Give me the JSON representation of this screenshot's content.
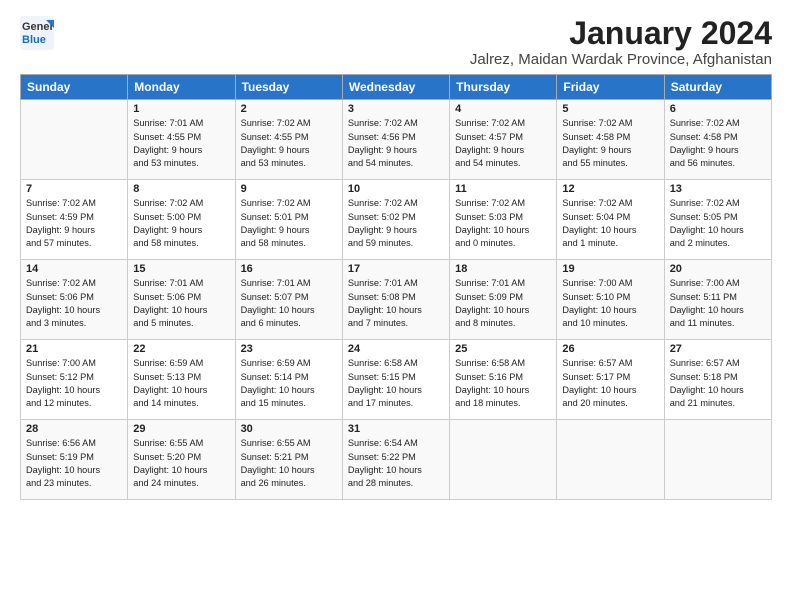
{
  "logo": {
    "general": "General",
    "blue": "Blue"
  },
  "title": "January 2024",
  "location": "Jalrez, Maidan Wardak Province, Afghanistan",
  "days_of_week": [
    "Sunday",
    "Monday",
    "Tuesday",
    "Wednesday",
    "Thursday",
    "Friday",
    "Saturday"
  ],
  "weeks": [
    [
      {
        "day": "",
        "info": ""
      },
      {
        "day": "1",
        "info": "Sunrise: 7:01 AM\nSunset: 4:55 PM\nDaylight: 9 hours\nand 53 minutes."
      },
      {
        "day": "2",
        "info": "Sunrise: 7:02 AM\nSunset: 4:55 PM\nDaylight: 9 hours\nand 53 minutes."
      },
      {
        "day": "3",
        "info": "Sunrise: 7:02 AM\nSunset: 4:56 PM\nDaylight: 9 hours\nand 54 minutes."
      },
      {
        "day": "4",
        "info": "Sunrise: 7:02 AM\nSunset: 4:57 PM\nDaylight: 9 hours\nand 54 minutes."
      },
      {
        "day": "5",
        "info": "Sunrise: 7:02 AM\nSunset: 4:58 PM\nDaylight: 9 hours\nand 55 minutes."
      },
      {
        "day": "6",
        "info": "Sunrise: 7:02 AM\nSunset: 4:58 PM\nDaylight: 9 hours\nand 56 minutes."
      }
    ],
    [
      {
        "day": "7",
        "info": "Sunrise: 7:02 AM\nSunset: 4:59 PM\nDaylight: 9 hours\nand 57 minutes."
      },
      {
        "day": "8",
        "info": "Sunrise: 7:02 AM\nSunset: 5:00 PM\nDaylight: 9 hours\nand 58 minutes."
      },
      {
        "day": "9",
        "info": "Sunrise: 7:02 AM\nSunset: 5:01 PM\nDaylight: 9 hours\nand 58 minutes."
      },
      {
        "day": "10",
        "info": "Sunrise: 7:02 AM\nSunset: 5:02 PM\nDaylight: 9 hours\nand 59 minutes."
      },
      {
        "day": "11",
        "info": "Sunrise: 7:02 AM\nSunset: 5:03 PM\nDaylight: 10 hours\nand 0 minutes."
      },
      {
        "day": "12",
        "info": "Sunrise: 7:02 AM\nSunset: 5:04 PM\nDaylight: 10 hours\nand 1 minute."
      },
      {
        "day": "13",
        "info": "Sunrise: 7:02 AM\nSunset: 5:05 PM\nDaylight: 10 hours\nand 2 minutes."
      }
    ],
    [
      {
        "day": "14",
        "info": "Sunrise: 7:02 AM\nSunset: 5:06 PM\nDaylight: 10 hours\nand 3 minutes."
      },
      {
        "day": "15",
        "info": "Sunrise: 7:01 AM\nSunset: 5:06 PM\nDaylight: 10 hours\nand 5 minutes."
      },
      {
        "day": "16",
        "info": "Sunrise: 7:01 AM\nSunset: 5:07 PM\nDaylight: 10 hours\nand 6 minutes."
      },
      {
        "day": "17",
        "info": "Sunrise: 7:01 AM\nSunset: 5:08 PM\nDaylight: 10 hours\nand 7 minutes."
      },
      {
        "day": "18",
        "info": "Sunrise: 7:01 AM\nSunset: 5:09 PM\nDaylight: 10 hours\nand 8 minutes."
      },
      {
        "day": "19",
        "info": "Sunrise: 7:00 AM\nSunset: 5:10 PM\nDaylight: 10 hours\nand 10 minutes."
      },
      {
        "day": "20",
        "info": "Sunrise: 7:00 AM\nSunset: 5:11 PM\nDaylight: 10 hours\nand 11 minutes."
      }
    ],
    [
      {
        "day": "21",
        "info": "Sunrise: 7:00 AM\nSunset: 5:12 PM\nDaylight: 10 hours\nand 12 minutes."
      },
      {
        "day": "22",
        "info": "Sunrise: 6:59 AM\nSunset: 5:13 PM\nDaylight: 10 hours\nand 14 minutes."
      },
      {
        "day": "23",
        "info": "Sunrise: 6:59 AM\nSunset: 5:14 PM\nDaylight: 10 hours\nand 15 minutes."
      },
      {
        "day": "24",
        "info": "Sunrise: 6:58 AM\nSunset: 5:15 PM\nDaylight: 10 hours\nand 17 minutes."
      },
      {
        "day": "25",
        "info": "Sunrise: 6:58 AM\nSunset: 5:16 PM\nDaylight: 10 hours\nand 18 minutes."
      },
      {
        "day": "26",
        "info": "Sunrise: 6:57 AM\nSunset: 5:17 PM\nDaylight: 10 hours\nand 20 minutes."
      },
      {
        "day": "27",
        "info": "Sunrise: 6:57 AM\nSunset: 5:18 PM\nDaylight: 10 hours\nand 21 minutes."
      }
    ],
    [
      {
        "day": "28",
        "info": "Sunrise: 6:56 AM\nSunset: 5:19 PM\nDaylight: 10 hours\nand 23 minutes."
      },
      {
        "day": "29",
        "info": "Sunrise: 6:55 AM\nSunset: 5:20 PM\nDaylight: 10 hours\nand 24 minutes."
      },
      {
        "day": "30",
        "info": "Sunrise: 6:55 AM\nSunset: 5:21 PM\nDaylight: 10 hours\nand 26 minutes."
      },
      {
        "day": "31",
        "info": "Sunrise: 6:54 AM\nSunset: 5:22 PM\nDaylight: 10 hours\nand 28 minutes."
      },
      {
        "day": "",
        "info": ""
      },
      {
        "day": "",
        "info": ""
      },
      {
        "day": "",
        "info": ""
      }
    ]
  ]
}
